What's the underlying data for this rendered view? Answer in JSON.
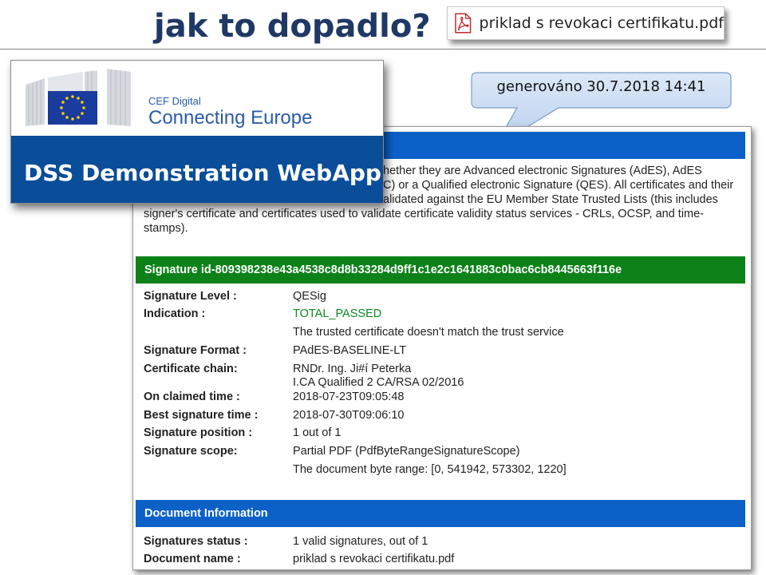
{
  "slide": {
    "title": "jak to dopadlo?",
    "file_name": "priklad s revokaci certifikatu.pdf",
    "callout": "generováno 30.7.2018  14:41"
  },
  "logo": {
    "cef_line1": "CEF Digital",
    "cef_line2": "Connecting Europe",
    "webapp_title": "DSS Demonstration WebApp"
  },
  "report": {
    "intro_lines": [
      "hether they are Advanced electronic Signatures (AdES), AdES",
      "C) or a Qualified electronic Signature (QES). All certificates and their",
      "alidated against the EU Member State Trusted Lists (this includes",
      "signer's certificate and certificates used to validate certificate validity status services - CRLs, OCSP, and time-",
      "stamps)."
    ],
    "signature_header": "Signature id-809398238e43a4538c8d8b33284d9ff1c1e2c1641883c0bac6cb8445663f116e",
    "fields": [
      {
        "label": "Signature Level :",
        "value": "QESig"
      },
      {
        "label": "Indication :",
        "value": "TOTAL_PASSED"
      },
      {
        "label": "",
        "value": "The trusted certificate doesn't match the trust service"
      },
      {
        "label": "Signature Format :",
        "value": "PAdES-BASELINE-LT"
      },
      {
        "label": "Certificate chain:",
        "value": "RNDr. Ing. Ji#í Peterka"
      },
      {
        "label": "",
        "value": "I.CA Qualified 2 CA/RSA 02/2016"
      },
      {
        "label": "On claimed time :",
        "value": "2018-07-23T09:05:48"
      },
      {
        "label": "Best signature time :",
        "value": "2018-07-30T09:06:10"
      },
      {
        "label": "Signature position :",
        "value": "1 out of 1"
      },
      {
        "label": "Signature scope:",
        "value": "Partial PDF (PdfByteRangeSignatureScope)"
      },
      {
        "label": "",
        "value": "The document byte range: [0, 541942, 573302, 1220]"
      }
    ],
    "document_header": "Document Information",
    "document_fields": [
      {
        "label": "Signatures status :",
        "value": "1 valid signatures, out of 1"
      },
      {
        "label": "Document name :",
        "value": "priklad s revokaci certifikatu.pdf"
      }
    ]
  },
  "colors": {
    "title": "#1f3864",
    "report_blue": "#0b61c8",
    "signature_green": "#0c8219",
    "passed_green": "#0c8a23",
    "webapp_blue": "#0a4d99",
    "callout_fill": "#c5d9f1"
  },
  "icons": [
    "pdf-file-icon",
    "eu-flag-icon"
  ]
}
